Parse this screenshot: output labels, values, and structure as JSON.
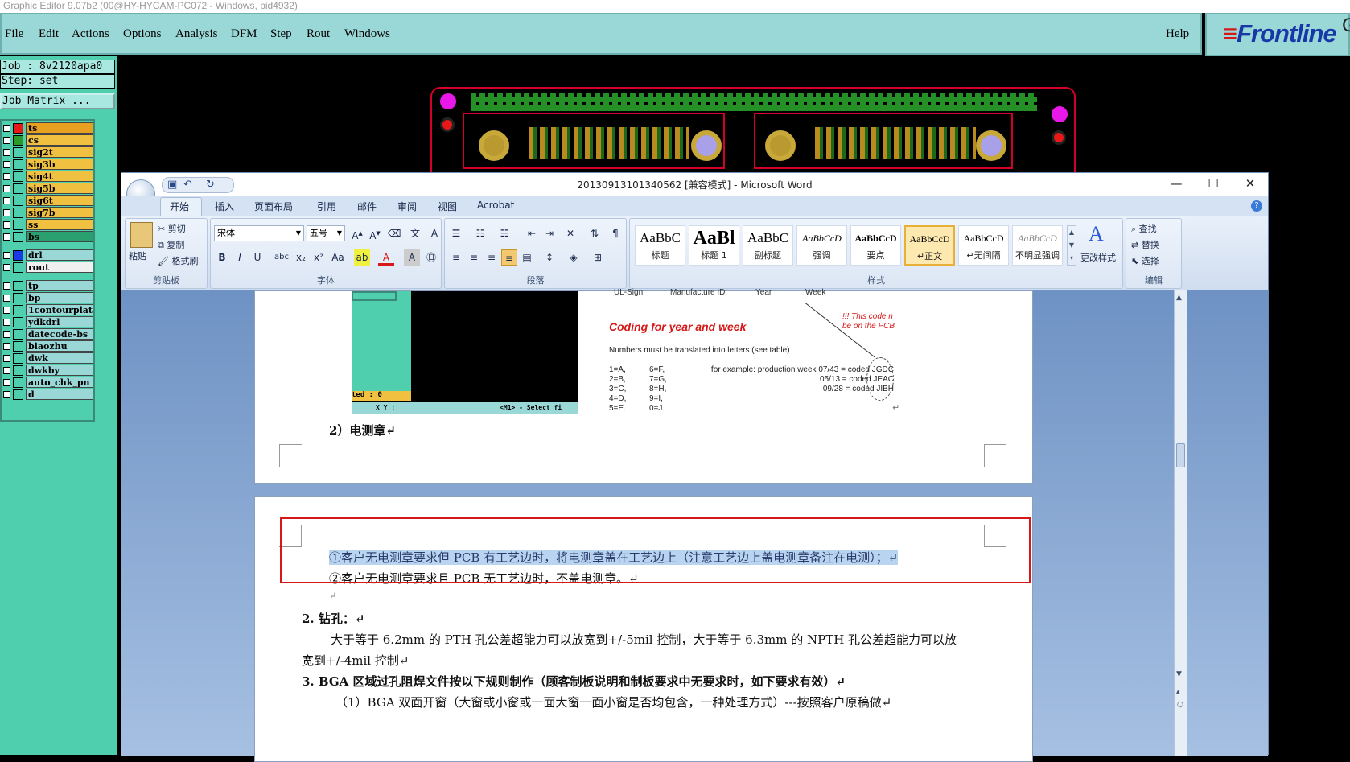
{
  "graphic_editor": {
    "title": "Graphic Editor 9.07b2 (00@HY-HYCAM-PC072 - Windows, pid4932)",
    "menu": [
      "File",
      "Edit",
      "Actions",
      "Options",
      "Analysis",
      "DFM",
      "Step",
      "Rout",
      "Windows"
    ],
    "help": "Help",
    "brand": "Frontline",
    "brand_suffix": "G",
    "job_label": "Job : 8v2120apa0",
    "step_label": "Step: set",
    "job_matrix_button": "Job Matrix ...",
    "layers_group1": [
      {
        "name": "ts",
        "color": "#e81818",
        "bg": "#e8a020"
      },
      {
        "name": "cs",
        "color": "#2a9a2a",
        "bg": "#f0c040"
      },
      {
        "name": "sig2t",
        "color": "#4fcfae",
        "bg": "#f0c040"
      },
      {
        "name": "sig3b",
        "color": "#4fcfae",
        "bg": "#f0c040"
      },
      {
        "name": "sig4t",
        "color": "#4fcfae",
        "bg": "#f0c040"
      },
      {
        "name": "sig5b",
        "color": "#4fcfae",
        "bg": "#f0c040"
      },
      {
        "name": "sig6t",
        "color": "#4fcfae",
        "bg": "#f0c040"
      },
      {
        "name": "sig7b",
        "color": "#4fcfae",
        "bg": "#f0c040"
      },
      {
        "name": "ss",
        "color": "#4fcfae",
        "bg": "#f0c040"
      },
      {
        "name": "bs",
        "color": "#4fcfae",
        "bg": "#2aa070"
      }
    ],
    "layers_group2": [
      {
        "name": "drl",
        "color": "#1a3ae8",
        "bg": "#9ad8d8"
      },
      {
        "name": "rout",
        "color": "#4fcfae",
        "bg": "#f0f0f0"
      }
    ],
    "layers_group3": [
      {
        "name": "tp"
      },
      {
        "name": "bp"
      },
      {
        "name": "1contourplat"
      },
      {
        "name": "ydkdrl"
      },
      {
        "name": "datecode-bs"
      },
      {
        "name": "biaozhu"
      },
      {
        "name": "dwk"
      },
      {
        "name": "dwkby"
      },
      {
        "name": "auto_chk_pn"
      },
      {
        "name": "d"
      }
    ]
  },
  "word": {
    "title": "20130913101340562 [兼容模式] - Microsoft Word",
    "tabs": [
      "开始",
      "插入",
      "页面布局",
      "引用",
      "邮件",
      "审阅",
      "视图",
      "Acrobat"
    ],
    "clipboard": {
      "paste": "粘贴",
      "cut": "剪切",
      "copy": "复制",
      "format_painter": "格式刷",
      "group": "剪贴板"
    },
    "font": {
      "name": "宋体",
      "size": "五号",
      "group": "字体"
    },
    "paragraph": {
      "group": "段落"
    },
    "styles": {
      "items": [
        {
          "preview": "AaBbC",
          "label": "标题"
        },
        {
          "preview": "AaBl",
          "label": "标题 1"
        },
        {
          "preview": "AaBbC",
          "label": "副标题"
        },
        {
          "preview": "AaBbCcD",
          "label": "强调"
        },
        {
          "preview": "AaBbCcD",
          "label": "要点"
        },
        {
          "preview": "AaBbCcD",
          "label": "↵正文"
        },
        {
          "preview": "AaBbCcD",
          "label": "↵无间隔"
        },
        {
          "preview": "AaBbCcD",
          "label": "不明显强调"
        }
      ],
      "change": "更改样式",
      "group": "样式"
    },
    "editing": {
      "find": "查找",
      "replace": "替换",
      "select": "选择",
      "group": "编辑"
    },
    "embedded": {
      "heading": "Coding for year and week",
      "subtitle": "Numbers must be translated into letters (see table)",
      "note": "!!! This code n be on the PCB",
      "col_a": [
        "1=A,",
        "2=B,",
        "3=C,",
        "4=D,",
        "5=E."
      ],
      "col_b": [
        "6=F,",
        "7=G,",
        "8=H,",
        "9=I,",
        "0=J."
      ],
      "example": [
        "for example: production week 07/43  = coded JGDC",
        "05/13  = coded JEAC",
        "09/28  = coded JIBH"
      ],
      "top_labels": [
        "UL-Sign",
        "Manufacture ID",
        "Year",
        "Week"
      ],
      "status_left": "ted : 0",
      "status_xy": "X Y :",
      "status_select": "<M1> - Select fi"
    },
    "doc": {
      "item2": "2）电测章↵",
      "line1": "①客户无电测章要求但 PCB 有工艺边时，将电测章盖在工艺边上（注意工艺边上盖电测章备注在电测）；↵",
      "line2": "②客户无电测章要求且 PCB 无工艺边时，不盖电测章。↵",
      "blank": "↵",
      "h2": "2. 钻孔：↵",
      "p1": "大于等于 6.2mm 的 PTH 孔公差超能力可以放宽到+/-5mil 控制，大于等于 6.3mm 的 NPTH 孔公差超能力可以放",
      "p1b": "宽到+/-4mil 控制↵",
      "h3": "3. BGA 区域过孔阻焊文件按以下规则制作（顾客制板说明和制板要求中无要求时，如下要求有效）↵",
      "p2": "（1）BGA 双面开窗（大窗或小窗或一面大窗一面小窗是否均包含，一种处理方式）---按照客户原稿做↵"
    }
  }
}
